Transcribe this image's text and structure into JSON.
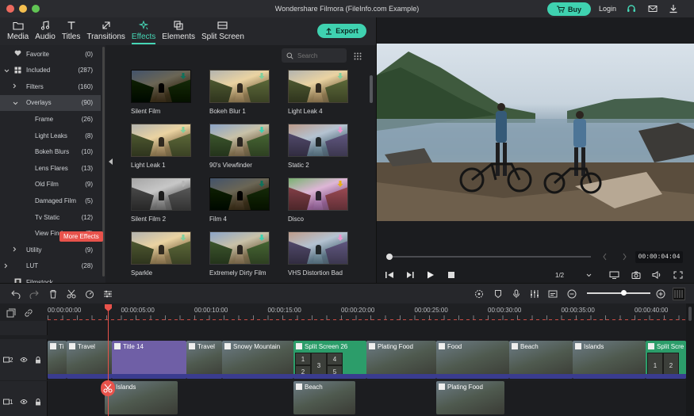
{
  "window": {
    "title": "Wondershare Filmora (FileInfo.com Example)",
    "buy_label": "Buy",
    "login_label": "Login"
  },
  "tabs": [
    {
      "label": "Media",
      "icon": "folder-icon"
    },
    {
      "label": "Audio",
      "icon": "music-note-icon"
    },
    {
      "label": "Titles",
      "icon": "text-t-icon"
    },
    {
      "label": "Transitions",
      "icon": "transition-icon"
    },
    {
      "label": "Effects",
      "icon": "effects-sparkle-icon",
      "active": true
    },
    {
      "label": "Elements",
      "icon": "elements-icon"
    },
    {
      "label": "Split Screen",
      "icon": "split-screen-icon"
    }
  ],
  "export_label": "Export",
  "sidebar": {
    "items": [
      {
        "label": "Favorite",
        "count": "(0)",
        "level": 0,
        "icon": "heart-icon"
      },
      {
        "label": "Included",
        "count": "(287)",
        "level": 0,
        "icon": "grid-icon",
        "expanded": true
      },
      {
        "label": "Filters",
        "count": "(160)",
        "level": 1
      },
      {
        "label": "Overlays",
        "count": "(90)",
        "level": 1,
        "expanded": true,
        "selected": true
      },
      {
        "label": "Frame",
        "count": "(26)",
        "level": 2
      },
      {
        "label": "Light Leaks",
        "count": "(8)",
        "level": 2
      },
      {
        "label": "Bokeh Blurs",
        "count": "(10)",
        "level": 2
      },
      {
        "label": "Lens Flares",
        "count": "(13)",
        "level": 2
      },
      {
        "label": "Old Film",
        "count": "(9)",
        "level": 2
      },
      {
        "label": "Damaged Film",
        "count": "(5)",
        "level": 2
      },
      {
        "label": "Tv Static",
        "count": "(12)",
        "level": 2
      },
      {
        "label": "View Finder",
        "count": "(7)",
        "level": 2
      },
      {
        "label": "Utility",
        "count": "(9)",
        "level": 1
      },
      {
        "label": "LUT",
        "count": "(28)",
        "level": 0
      },
      {
        "label": "Filmstock",
        "count": "",
        "level": 0,
        "icon": "film-icon"
      }
    ],
    "more_effects_label": "More Effects"
  },
  "search": {
    "placeholder": "Search",
    "value": ""
  },
  "effects": [
    {
      "name": "Silent Film",
      "style": "dark"
    },
    {
      "name": "Bokeh Blur 1",
      "style": "warm"
    },
    {
      "name": "Light Leak 4",
      "style": "warm"
    },
    {
      "name": "Light Leak 1",
      "style": "warm"
    },
    {
      "name": "90's Viewfinder",
      "style": "normal"
    },
    {
      "name": "Static 2",
      "style": "cool"
    },
    {
      "name": "Silent Film 2",
      "style": "bw"
    },
    {
      "name": "Film 4",
      "style": "dark"
    },
    {
      "name": "Disco",
      "style": "purple"
    },
    {
      "name": "Sparkle",
      "style": "warm"
    },
    {
      "name": "Extremely Dirty Film",
      "style": "normal"
    },
    {
      "name": "VHS Distortion Bad",
      "style": "cool"
    }
  ],
  "preview": {
    "timecode": "00:00:04:04",
    "ratio": "1/2",
    "progress": 0.02
  },
  "timeline": {
    "ruler": [
      "00:00:00:00",
      "00:00:05:00",
      "00:00:10:00",
      "00:00:15:00",
      "00:00:20:00",
      "00:00:25:00",
      "00:00:30:00",
      "00:00:35:00",
      "00:00:40:00"
    ],
    "zoom": 0.55,
    "tracks": [
      {
        "label": "2",
        "clips": [
          {
            "title": "Ti",
            "kind": "video"
          },
          {
            "title": "Travel",
            "kind": "video"
          },
          {
            "title": "Title 14",
            "kind": "title"
          },
          {
            "title": "Travel",
            "kind": "video"
          },
          {
            "title": "Snowy Mountain",
            "kind": "video"
          },
          {
            "title": "Split Screen 26",
            "kind": "split"
          },
          {
            "title": "Plating Food",
            "kind": "video"
          },
          {
            "title": "Food",
            "kind": "video"
          },
          {
            "title": "Beach",
            "kind": "video"
          },
          {
            "title": "Islands",
            "kind": "video"
          },
          {
            "title": "Split Scre",
            "kind": "split"
          }
        ]
      },
      {
        "label": "1",
        "clips": [
          {
            "title": "Islands",
            "kind": "video"
          },
          {
            "title": "Beach",
            "kind": "video"
          },
          {
            "title": "Plating Food",
            "kind": "video"
          }
        ]
      }
    ],
    "split_cells": [
      "1",
      "2",
      "3",
      "4",
      "5"
    ],
    "split_cells_b": [
      "1",
      "2"
    ]
  }
}
